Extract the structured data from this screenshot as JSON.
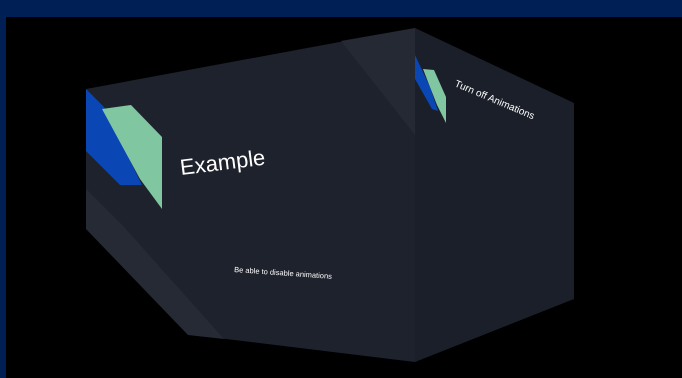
{
  "slide_front": {
    "title": "Example",
    "subtitle": "Be able to disable animations"
  },
  "slide_side": {
    "title": "Turn off Animations"
  },
  "colors": {
    "frame": "#001f54",
    "face_dark": "#1e222c",
    "face_side": "#1b1f29",
    "stripe": "#272b35",
    "accent_blue": "#0a46b4",
    "accent_green": "#7fc6a1"
  }
}
